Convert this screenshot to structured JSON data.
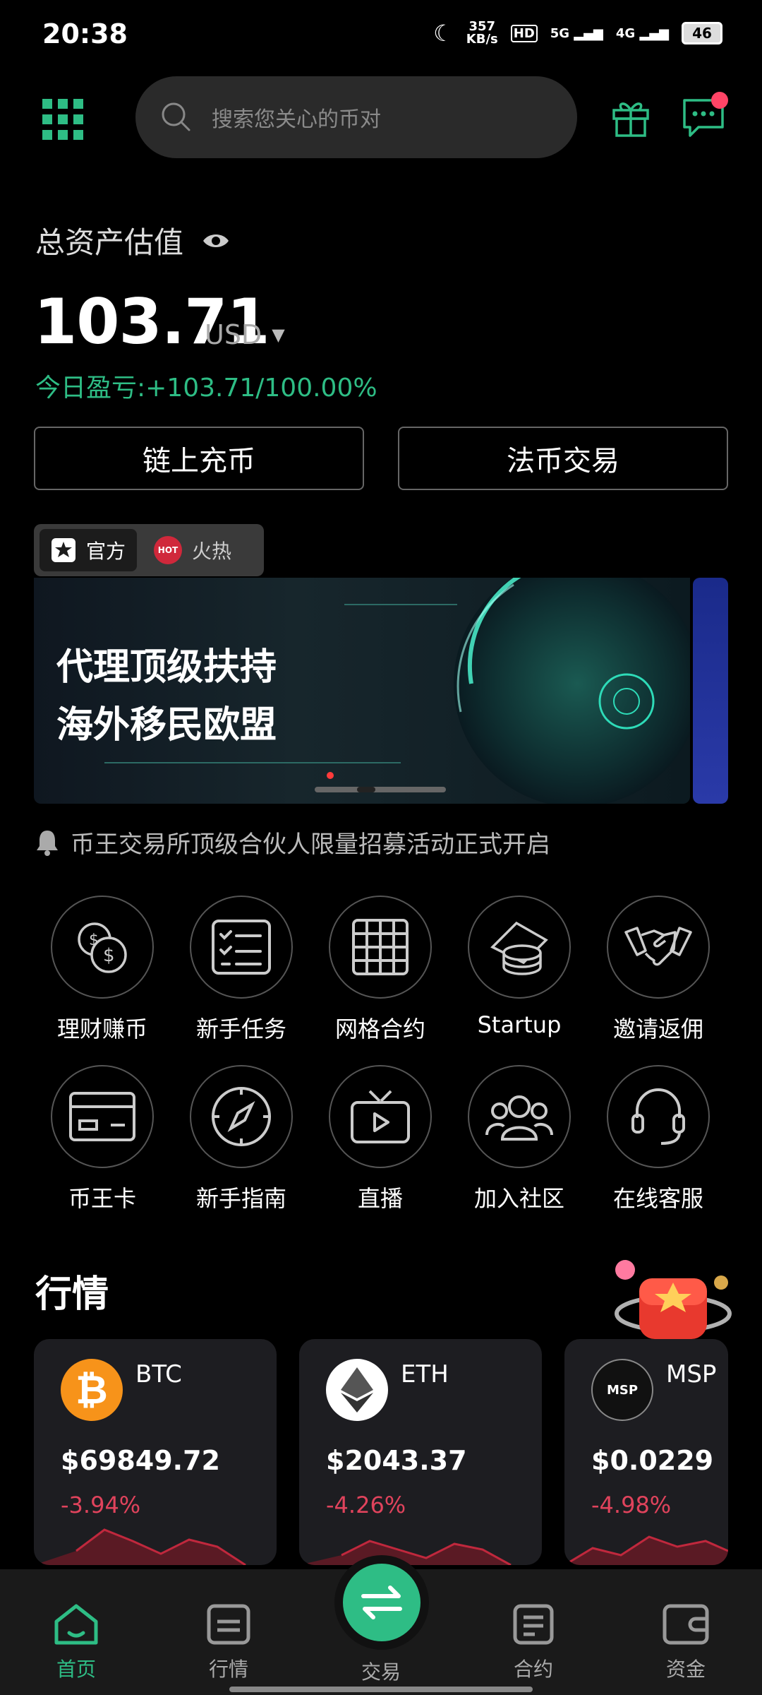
{
  "status_bar": {
    "time": "20:38",
    "net_speed_value": "357",
    "net_speed_unit": "KB/s",
    "hd": "HD",
    "sig1": "5G",
    "sig2": "4G",
    "battery": "46"
  },
  "header": {
    "search_placeholder": "搜索您关心的币对"
  },
  "assets": {
    "title": "总资产估值",
    "value": "103.71",
    "currency": "USD",
    "pnl": "今日盈亏:+103.71/100.00%",
    "deposit_label": "链上充币",
    "fiat_label": "法币交易"
  },
  "tabs": [
    {
      "label": "官方",
      "active": true
    },
    {
      "label": "火热",
      "badge": "HOT",
      "active": false
    }
  ],
  "banner": {
    "line1": "代理顶级扶持",
    "line2": "海外移民欧盟"
  },
  "notice": "币王交易所顶级合伙人限量招募活动正式开启",
  "shortcuts": [
    {
      "label": "理财赚币",
      "icon": "coins-icon"
    },
    {
      "label": "新手任务",
      "icon": "checklist-icon"
    },
    {
      "label": "网格合约",
      "icon": "grid-icon"
    },
    {
      "label": "Startup",
      "icon": "token-stack-icon"
    },
    {
      "label": "邀请返佣",
      "icon": "handshake-icon"
    },
    {
      "label": "币王卡",
      "icon": "card-icon"
    },
    {
      "label": "新手指南",
      "icon": "compass-icon"
    },
    {
      "label": "直播",
      "icon": "tv-icon"
    },
    {
      "label": "加入社区",
      "icon": "community-icon"
    },
    {
      "label": "在线客服",
      "icon": "headset-icon"
    }
  ],
  "market": {
    "title": "行情",
    "coins": [
      {
        "name": "BTC",
        "price": "$69849.72",
        "change": "-3.94%",
        "color": "#f7931a"
      },
      {
        "name": "ETH",
        "price": "$2043.37",
        "change": "-4.26%",
        "color": "#ffffff"
      },
      {
        "name": "MSP",
        "price": "$0.0229",
        "change": "-4.98%",
        "color": "#111111",
        "logo_text": "MSP"
      }
    ]
  },
  "bottom_nav": [
    {
      "label": "首页",
      "active": true
    },
    {
      "label": "行情",
      "active": false
    },
    {
      "label": "交易",
      "active": false
    },
    {
      "label": "合约",
      "active": false
    },
    {
      "label": "资金",
      "active": false
    }
  ],
  "colors": {
    "accent": "#2ebd85",
    "down": "#e0435c",
    "background": "#000000"
  }
}
